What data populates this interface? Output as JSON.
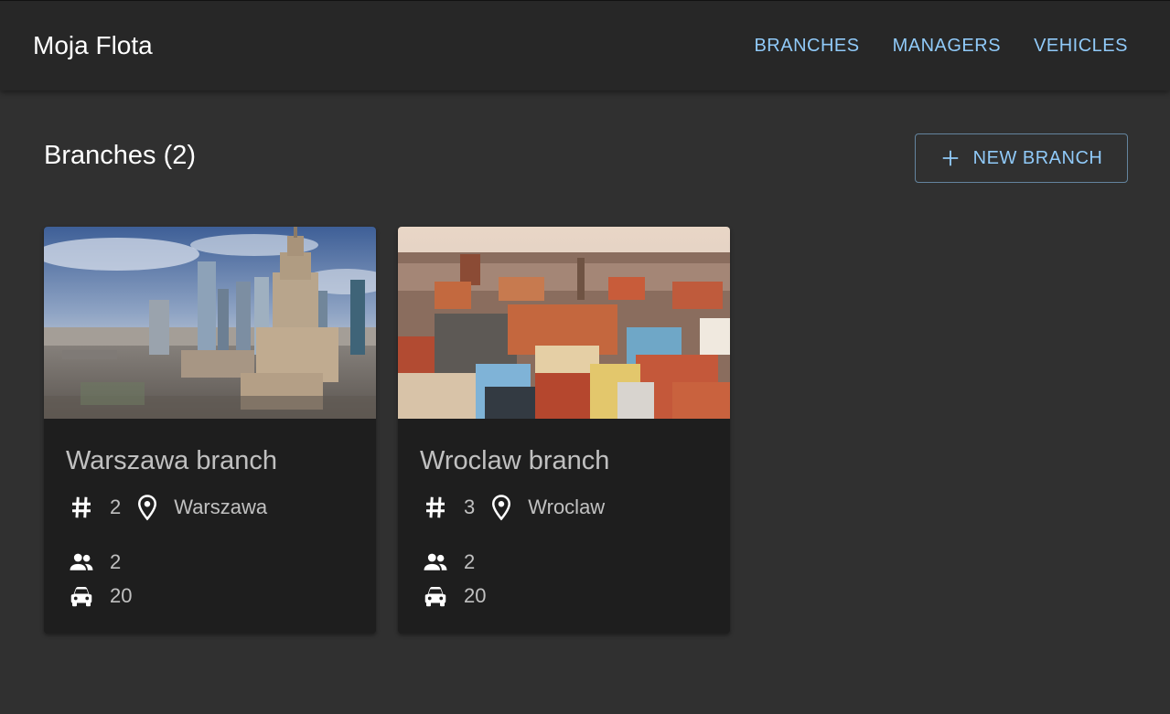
{
  "app": {
    "title": "Moja Flota",
    "nav": [
      {
        "label": "BRANCHES"
      },
      {
        "label": "MANAGERS"
      },
      {
        "label": "VEHICLES"
      }
    ]
  },
  "page": {
    "heading": "Branches (2)",
    "new_button_label": "NEW BRANCH"
  },
  "branches": [
    {
      "name": "Warszawa branch",
      "id": "2",
      "city": "Warszawa",
      "managers": "2",
      "vehicles": "20"
    },
    {
      "name": "Wroclaw branch",
      "id": "3",
      "city": "Wroclaw",
      "managers": "2",
      "vehicles": "20"
    }
  ],
  "colors": {
    "background": "#303030",
    "appbar": "#272727",
    "card": "#1e1e1e",
    "accent": "#90caf9"
  },
  "icons": [
    "plus-icon",
    "hash-icon",
    "location-pin-icon",
    "people-icon",
    "car-icon"
  ]
}
